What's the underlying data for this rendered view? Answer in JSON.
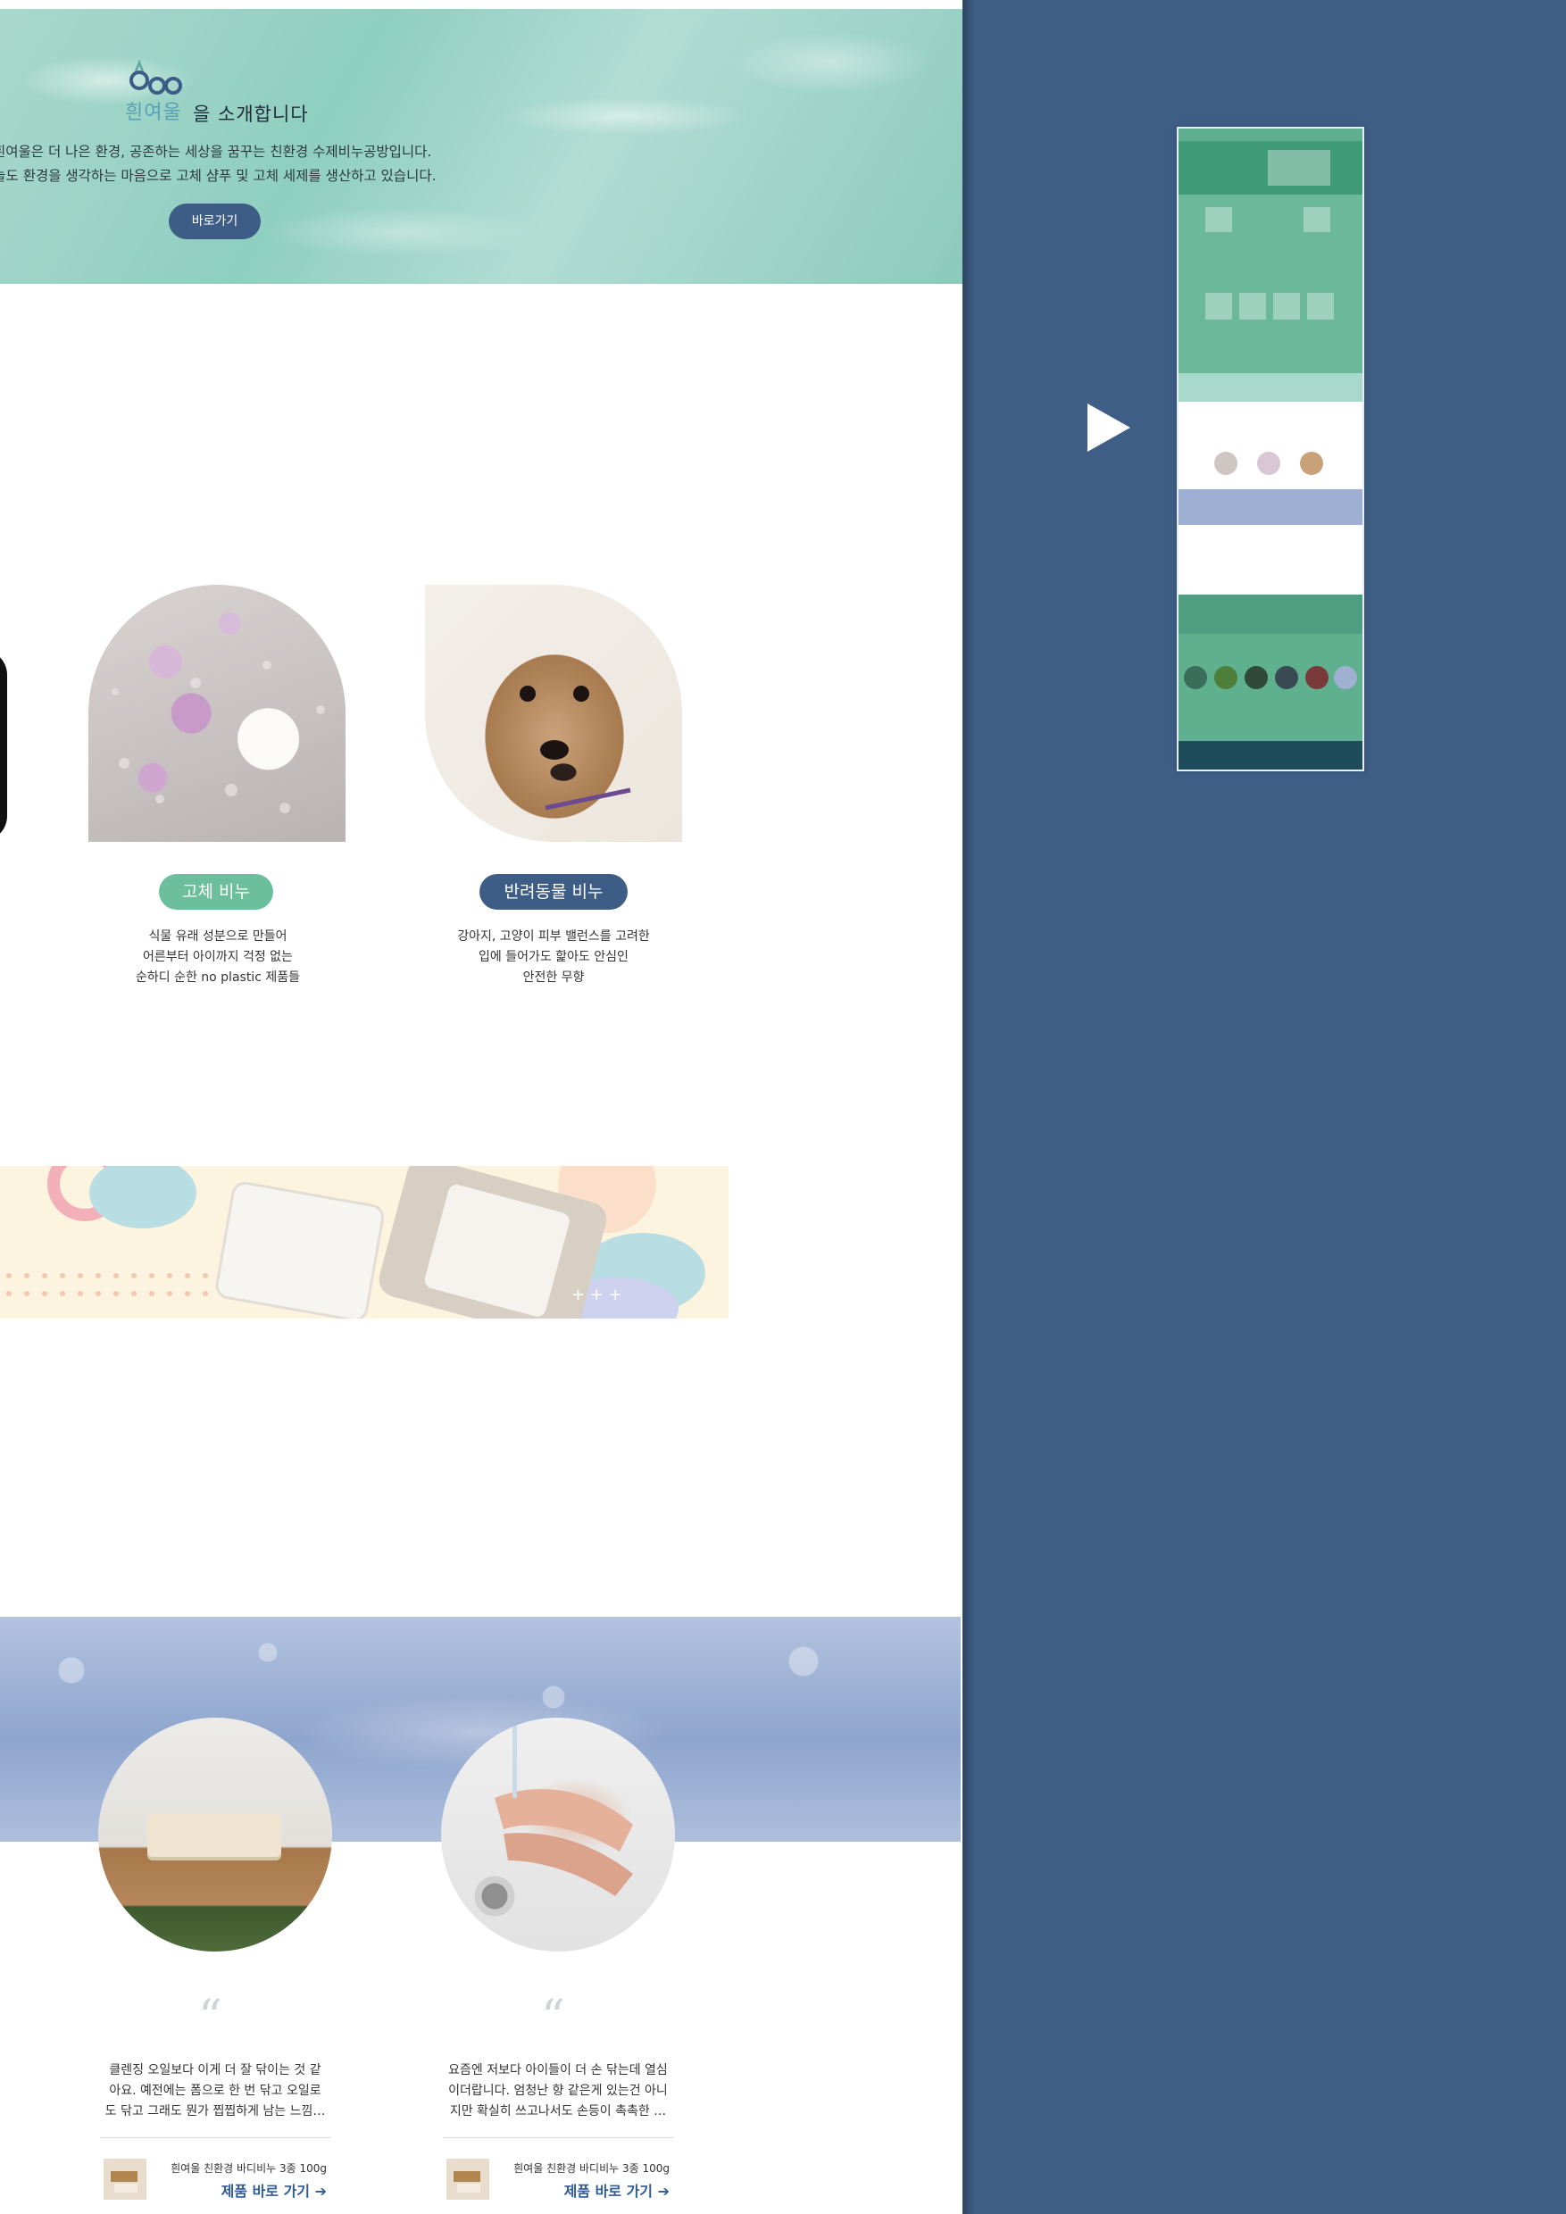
{
  "hero": {
    "logo_text": "흰여울",
    "title_suffix": "을 소개합니다",
    "desc_line1": "흰여울은 더 나은 환경, 공존하는 세상을 꿈꾸는 친환경 수제비누공방입니다.",
    "desc_line2": "오늘도 환경을 생각하는 마음으로 고체 샴푸 및 고체 세제를 생산하고 있습니다.",
    "button_label": "바로가기"
  },
  "products": [
    {
      "label": "고체 비누",
      "color": "#6cbf9d",
      "line1": "식물 유래 성분으로 만들어",
      "line2": "어른부터 아이까지 걱정 없는",
      "line3": "순하디 순한 no plastic 제품들"
    },
    {
      "label": "반려동물 비누",
      "color": "#3d5d86",
      "line1": "강아지, 고양이 피부 밸런스를 고려한",
      "line2": "입에 들어가도 핥아도 안심인",
      "line3": "안전한 무향"
    }
  ],
  "reviews": [
    {
      "quote_mark": "“",
      "line1": "클렌징 오일보다 이게 더 잘 닦이는 것 같",
      "line2": "아요. 예전에는 폼으로 한 번 닦고 오일로",
      "line3": "도 닦고 그래도 뭔가 찝찝하게 남는 느낌…",
      "product": "흰여울 친환경 바디비누 3종 100g",
      "link": "제품 바로 가기 ➔"
    },
    {
      "quote_mark": "“",
      "line1": "요즘엔 저보다 아이들이 더 손 닦는데 열심",
      "line2": "이더랍니다. 엄청난 향 같은게 있는건 아니",
      "line3": "지만 확실히 쓰고나서도 손등이 촉촉한 …",
      "product": "흰여울 친환경 바디비누 3종 100g",
      "link": "제품 바로 가기 ➔"
    }
  ],
  "colors": {
    "accent_green": "#6cbf9d",
    "accent_navy": "#3d5d86",
    "side_panel": "#3f5e86",
    "link_blue": "#2f5b96"
  }
}
